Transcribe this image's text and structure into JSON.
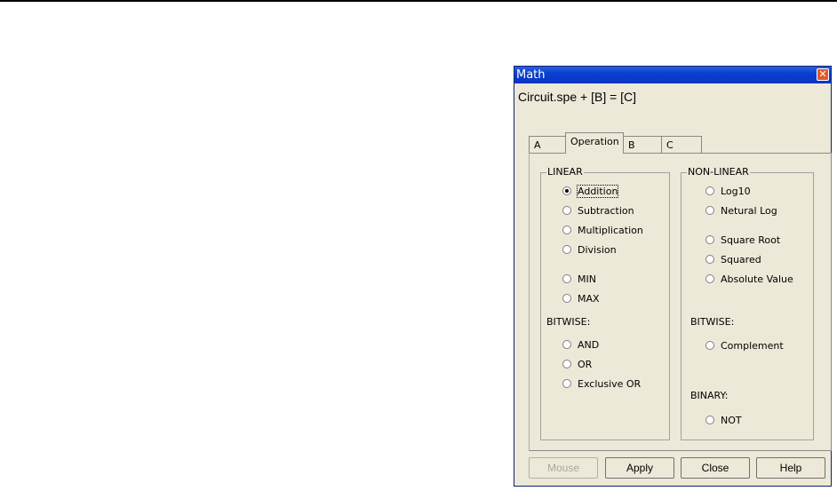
{
  "window": {
    "title": "Math",
    "close_icon": "close-icon"
  },
  "formula": "Circuit.spe + [B] = [C]",
  "tabs": [
    {
      "label": "A",
      "active": false
    },
    {
      "label": "Operation",
      "active": true
    },
    {
      "label": "B",
      "active": false
    },
    {
      "label": "C",
      "active": false
    }
  ],
  "left_panel": {
    "title": "LINEAR",
    "linear": [
      "Addition",
      "Subtraction",
      "Multiplication",
      "Division"
    ],
    "minmax": [
      "MIN",
      "MAX"
    ],
    "bitwise_title": "BITWISE:",
    "bitwise": [
      "AND",
      "OR",
      "Exclusive OR"
    ]
  },
  "right_panel": {
    "title": "NON-LINEAR",
    "logs": [
      "Log10",
      "Netural Log"
    ],
    "powers": [
      "Square Root",
      "Squared",
      "Absolute Value"
    ],
    "bitwise_title": "BITWISE:",
    "bitwise": [
      "Complement"
    ],
    "binary_title": "BINARY:",
    "binary": [
      "NOT"
    ]
  },
  "selected_operation": "Addition",
  "buttons": {
    "mouse": "Mouse",
    "apply": "Apply",
    "close": "Close",
    "help": "Help"
  }
}
